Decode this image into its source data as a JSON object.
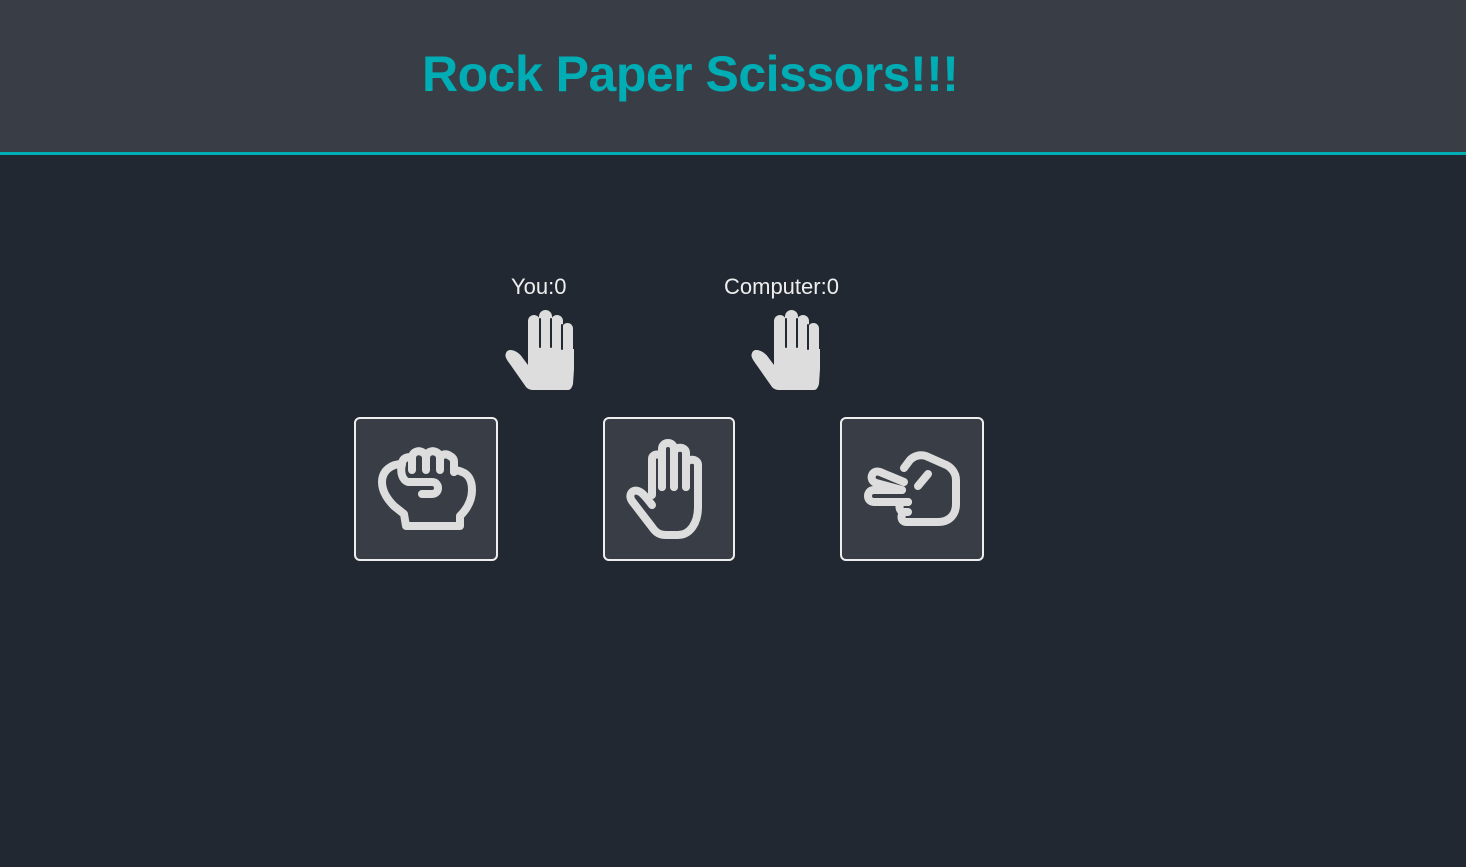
{
  "app": {
    "title": "Rock Paper Scissors!!!"
  },
  "scoreboard": {
    "you_label": "You:0",
    "computer_label": "Computer:0"
  },
  "choices": [
    {
      "name": "rock",
      "icon": "fist-icon"
    },
    {
      "name": "paper",
      "icon": "open-hand-icon"
    },
    {
      "name": "scissors",
      "icon": "scissors-hand-icon"
    }
  ],
  "picks": {
    "you": "paper",
    "computer": "paper"
  },
  "colors": {
    "background": "#222831",
    "header": "#393e46",
    "accent": "#00adb5",
    "text": "#eeeeee",
    "icon": "#dddddd"
  }
}
